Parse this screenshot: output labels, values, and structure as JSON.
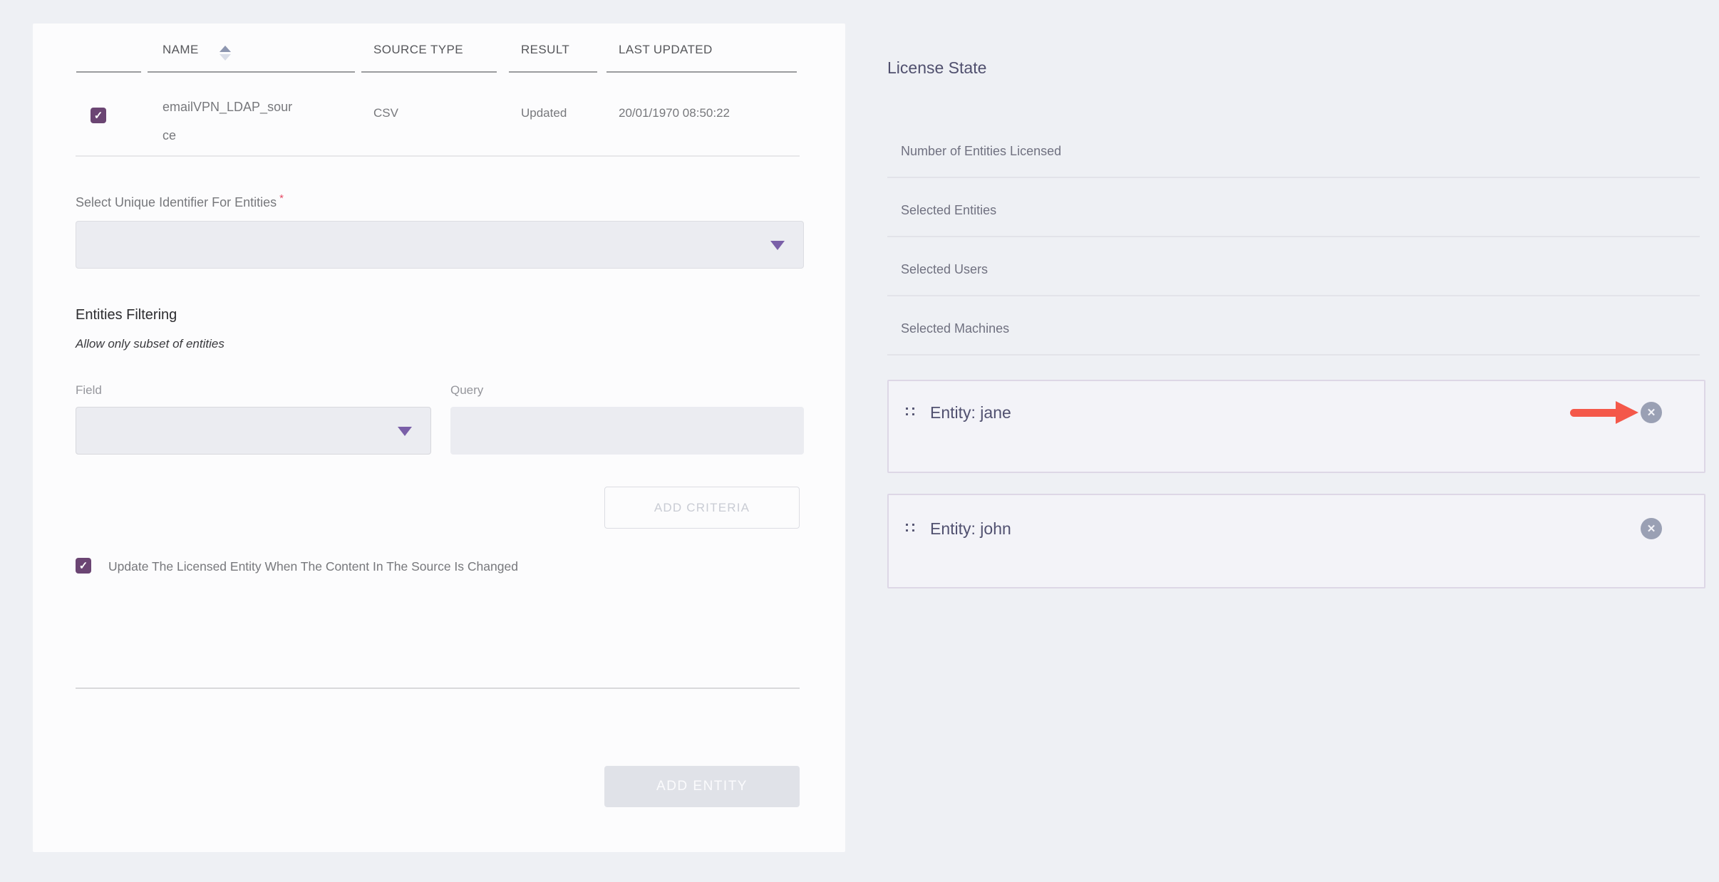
{
  "colors": {
    "page_background": "#eef0f4",
    "card_background": "#fcfcfd",
    "accent_purple": "#6b4573",
    "caret_purple": "#7a5fa8",
    "required_red": "#e64c66",
    "annotation_arrow_red": "#f4584a",
    "close_icon_gray": "#9aa0b4",
    "heading_slate": "#50506e"
  },
  "table": {
    "headers": {
      "name": "NAME",
      "source_type": "SOURCE TYPE",
      "result": "RESULT",
      "last_updated": "LAST UPDATED"
    },
    "row": {
      "checked": true,
      "name": "emailVPN_LDAP_source",
      "source_type": "CSV",
      "result": "Updated",
      "last_updated": "20/01/1970 08:50:22"
    }
  },
  "form": {
    "unique_id_label": "Select Unique Identifier For Entities",
    "required_marker": "*",
    "unique_id_value": "",
    "filtering_title": "Entities Filtering",
    "filtering_subtitle": "Allow only subset of entities",
    "field_label": "Field",
    "field_value": "",
    "query_label": "Query",
    "query_value": "",
    "add_criteria": "ADD CRITERIA",
    "update_checkbox_checked": true,
    "update_checkbox_label": "Update The Licensed Entity When The Content In The Source Is Changed",
    "add_entity": "ADD ENTITY"
  },
  "license": {
    "title": "License State",
    "items": [
      "Number of Entities Licensed",
      "Selected Entities",
      "Selected Users",
      "Selected Machines"
    ],
    "entities": [
      {
        "label": "Entity: jane"
      },
      {
        "label": "Entity: john"
      }
    ]
  }
}
